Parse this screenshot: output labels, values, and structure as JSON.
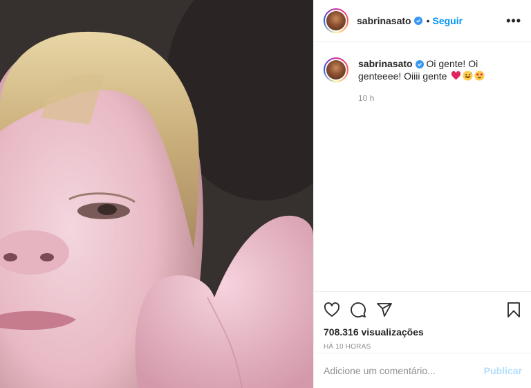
{
  "post": {
    "username": "sabrinasato",
    "follow_label": "Seguir",
    "separator": "•",
    "more_label": "•••"
  },
  "caption": {
    "username": "sabrinasato",
    "text": "Oi gente! Oi genteeee! Oiiii gente",
    "emojis": [
      "heart-emoji",
      "grinning-sweat-emoji",
      "heart-eyes-emoji"
    ],
    "time": "10 h"
  },
  "stats": {
    "views": "708.316 visualizações",
    "time_ago": "HÁ 10 HORAS"
  },
  "comment_box": {
    "placeholder": "Adicione um comentário...",
    "publish_label": "Publicar"
  },
  "icons": {
    "like": "heart-icon",
    "comment": "comment-icon",
    "share": "share-icon",
    "save": "bookmark-icon"
  },
  "colors": {
    "follow": "#0095f6",
    "publish_disabled": "#b2dffc",
    "verified": "#3897f0",
    "muted": "#8e8e8e"
  }
}
